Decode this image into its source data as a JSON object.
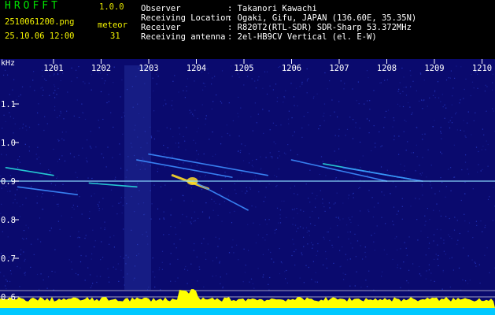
{
  "header": {
    "app_name": "HROFFT",
    "version": "1.0.0",
    "filename": "2510061200.png",
    "datetime": "25.10.06 12:00",
    "detection_label": "meteor",
    "detection_count": "31",
    "info_labels": [
      "Observer",
      "Receiving Location",
      "Receiver",
      "Receiving antenna"
    ],
    "info_values": [
      ": Takanori Kawachi",
      ": Ogaki, Gifu, JAPAN (136.60E, 35.35N)",
      ": R820T2(RTL-SDR) SDR-Sharp 53.372MHz",
      ": 2el-HB9CV Vertical (el. E-W)"
    ]
  },
  "spectrogram": {
    "y_unit": "kHz",
    "y_ticks": [
      "1.1",
      "1.0",
      "0.9",
      "0.8",
      "0.7",
      "0.6"
    ],
    "time_ticks": [
      "1201",
      "1202",
      "1203",
      "1204",
      "1205",
      "1206",
      "1207",
      "1208",
      "1209",
      "1210"
    ],
    "colors": {
      "background": "#0a0a6e",
      "noise_fg": "#2a40d0",
      "trail_hot": "#ffdc28",
      "trail_warm": "#28dcdc",
      "trail_cool": "#3c8cff",
      "carrier": "#8cdcff",
      "level_fill": "#ffff00",
      "level_base": "#00c8ff",
      "gridline": "#ffffff"
    }
  },
  "chart_data": {
    "type": "heatmap",
    "x_unit": "time (HHMM)",
    "y_unit": "kHz",
    "xlim": [
      "1200",
      "1210"
    ],
    "ylim": [
      0.6,
      1.16
    ],
    "carrier_khz": 0.9,
    "detected_meteors": 31,
    "trails": [
      {
        "t": [
          "1200:00",
          "1201:00"
        ],
        "khz": [
          0.935,
          0.915
        ]
      },
      {
        "t": [
          "1202:45",
          "1204:45"
        ],
        "khz": [
          0.955,
          0.91
        ]
      },
      {
        "t": [
          "1203:00",
          "1205:30"
        ],
        "khz": [
          0.97,
          0.915
        ]
      },
      {
        "t": [
          "1203:30",
          "1204:15"
        ],
        "khz": [
          0.915,
          0.88
        ]
      },
      {
        "t": [
          "1204:00",
          "1205:05"
        ],
        "khz": [
          0.895,
          0.825
        ]
      },
      {
        "t": [
          "1206:00",
          "1208:00"
        ],
        "khz": [
          0.955,
          0.9
        ]
      },
      {
        "t": [
          "1206:40",
          "1208:30"
        ],
        "khz": [
          0.945,
          0.905
        ]
      },
      {
        "t": [
          "1207:05",
          "1208:45"
        ],
        "khz": [
          0.935,
          0.9
        ]
      },
      {
        "t": [
          "1200:15",
          "1201:30"
        ],
        "khz": [
          0.885,
          0.865
        ]
      },
      {
        "t": [
          "1201:45",
          "1202:45"
        ],
        "khz": [
          0.895,
          0.885
        ]
      }
    ]
  }
}
